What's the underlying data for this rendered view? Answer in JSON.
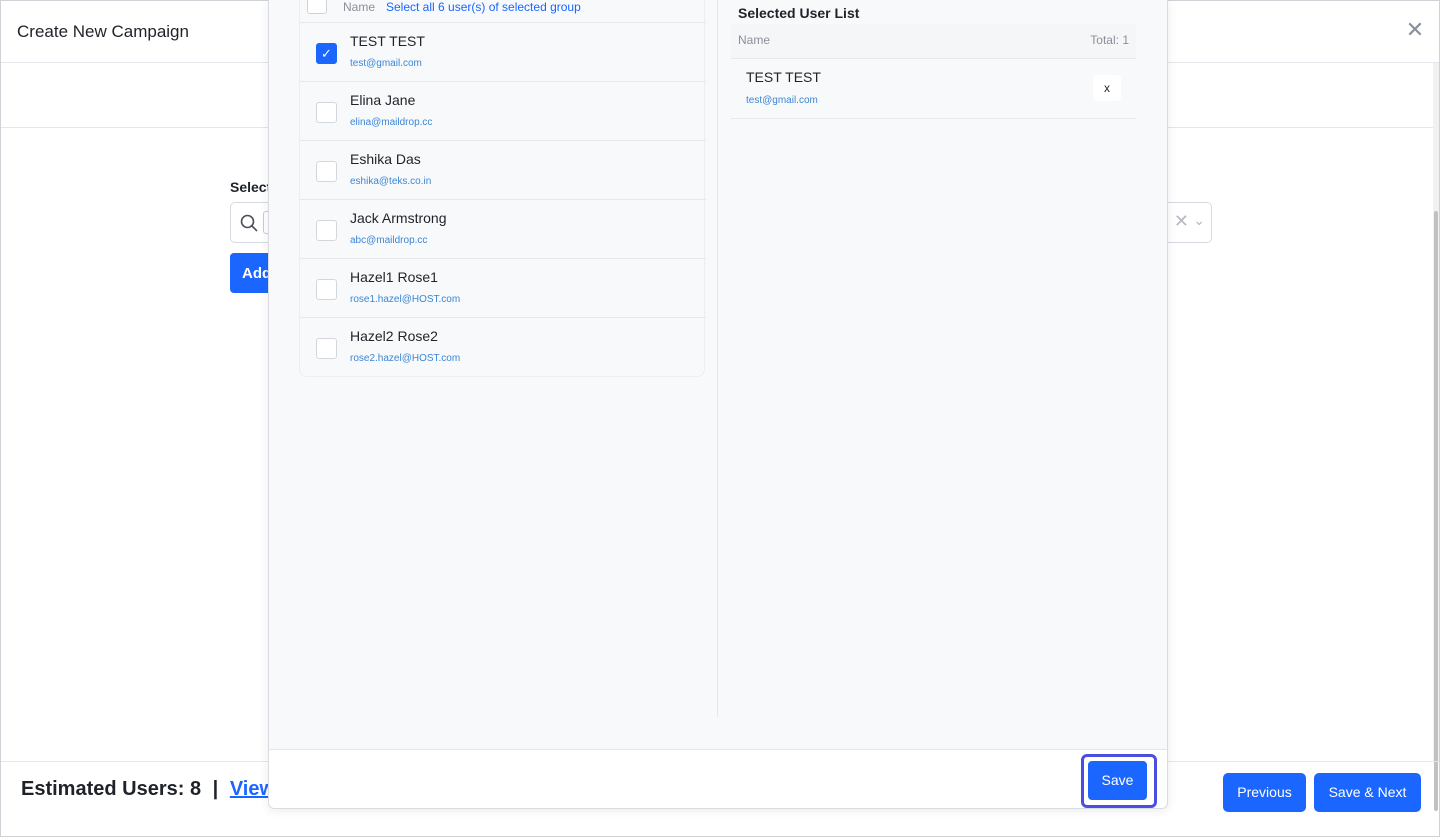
{
  "outer": {
    "title": "Create New Campaign",
    "close_icon": "close-icon",
    "select_label": "Select",
    "add_button_label": "Add",
    "estimated_users_label": "Estimated Users: 8",
    "separator": "|",
    "view_link": "View",
    "previous_label": "Previous",
    "save_next_label": "Save & Next"
  },
  "user_list": {
    "header_name": "Name",
    "select_all_text": "Select all 6 user(s) of selected group",
    "users": [
      {
        "name": "TEST TEST",
        "email": "test@gmail.com",
        "checked": true
      },
      {
        "name": "Elina Jane",
        "email": "elina@maildrop.cc",
        "checked": false
      },
      {
        "name": "Eshika Das",
        "email": "eshika@teks.co.in",
        "checked": false
      },
      {
        "name": "Jack Armstrong",
        "email": "abc@maildrop.cc",
        "checked": false
      },
      {
        "name": "Hazel1 Rose1",
        "email": "rose1.hazel@HOST.com",
        "checked": false
      },
      {
        "name": "Hazel2 Rose2",
        "email": "rose2.hazel@HOST.com",
        "checked": false
      }
    ]
  },
  "selected_list": {
    "title": "Selected User List",
    "header_name": "Name",
    "total": "Total: 1",
    "items": [
      {
        "name": "TEST TEST",
        "email": "test@gmail.com",
        "remove_label": "x"
      }
    ]
  },
  "modal": {
    "save_label": "Save"
  },
  "colors": {
    "accent": "#1a66ff",
    "focus_ring": "#4a4fe0",
    "email": "#3a86d6"
  }
}
